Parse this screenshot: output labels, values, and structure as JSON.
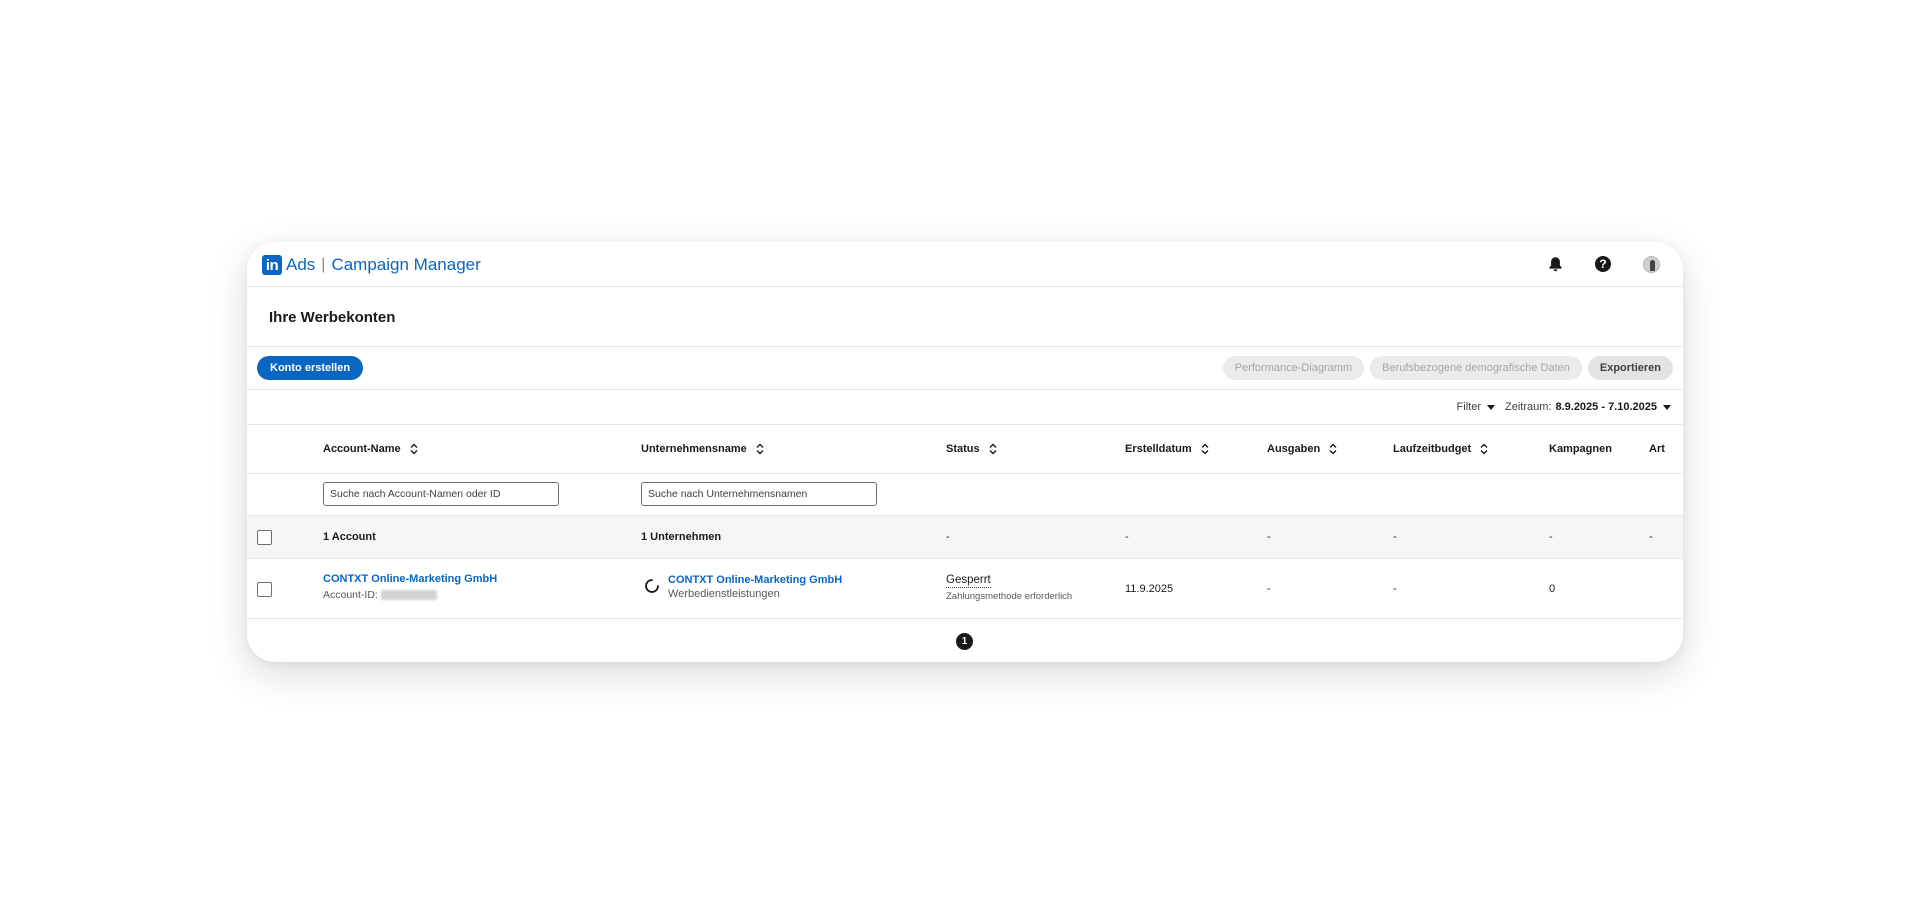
{
  "app": {
    "logo_in": "in",
    "product": "Ads",
    "separator": "|",
    "title": "Campaign Manager"
  },
  "page": {
    "title": "Ihre Werbekonten"
  },
  "toolbar": {
    "create_label": "Konto erstellen",
    "performance_label": "Performance-Diagramm",
    "demographics_label": "Berufsbezogene demografische Daten",
    "export_label": "Exportieren"
  },
  "filters": {
    "filter_label": "Filter",
    "date_range_label": "Zeitraum:",
    "date_range_value": "8.9.2025 - 7.10.2025"
  },
  "table": {
    "columns": [
      "Account-Name",
      "Unternehmensname",
      "Status",
      "Erstelldatum",
      "Ausgaben",
      "Laufzeitbudget",
      "Kampagnen",
      "Art"
    ],
    "search_account_placeholder": "Suche nach Account-Namen oder ID",
    "search_company_placeholder": "Suche nach Unternehmensnamen",
    "summary": {
      "accounts": "1 Account",
      "companies": "1 Unternehmen",
      "status": "-",
      "created": "-",
      "spend": "-",
      "budget": "-",
      "campaigns": "-",
      "type": "-"
    },
    "rows": [
      {
        "account_name": "CONTXT Online-Marketing GmbH",
        "account_id_label": "Account-ID:",
        "company_name": "CONTXT Online-Marketing GmbH",
        "company_industry": "Werbedienstleistungen",
        "status": "Gesperrt",
        "status_detail": "Zahlungsmethode erforderlich",
        "created": "11.9.2025",
        "spend": "-",
        "budget": "-",
        "campaigns": "0"
      }
    ]
  },
  "pagination": {
    "current_page": "1"
  },
  "colors": {
    "brand": "#0a66c2",
    "text": "#191919",
    "summary_bg": "#f5f6f7"
  }
}
